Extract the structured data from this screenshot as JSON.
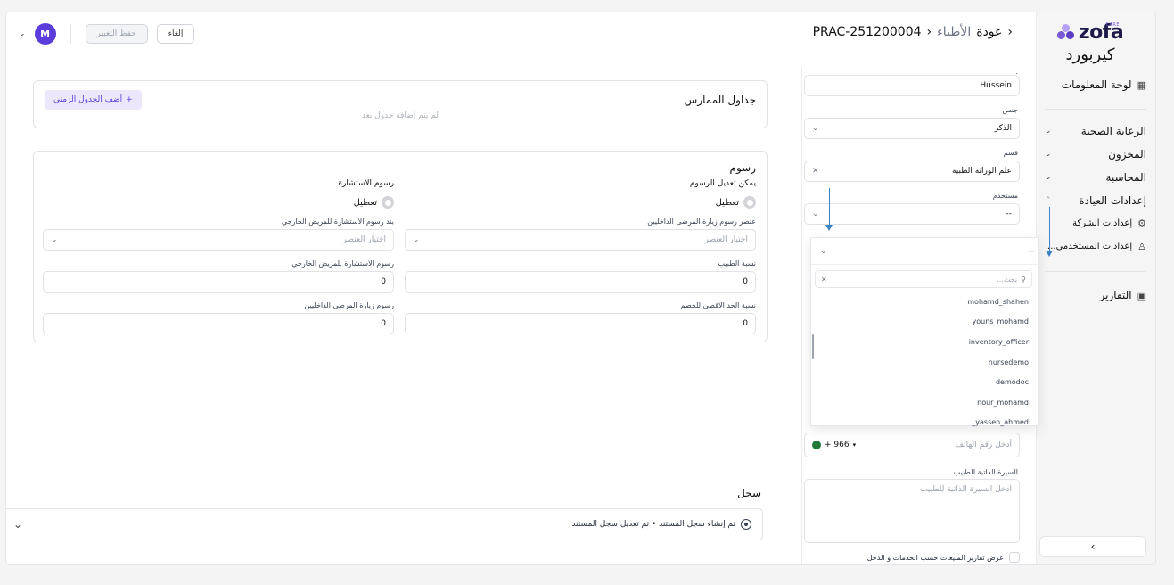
{
  "sidebar": {
    "logo_text": "zofa",
    "logo_badge": "CARE",
    "logo_subtitle": "كيربورد",
    "dashboard": "لوحة المعلومات",
    "healthcare": "الرعاية الصحية",
    "inventory": "المخزون",
    "accounting": "المحاسبة",
    "clinic_settings": "إعدادات العيادة",
    "company_settings": "إعدادات الشركة",
    "user_settings": "إعدادات المستخدمي...",
    "reports": "التقارير",
    "collapse": "›"
  },
  "header": {
    "back": "عودة",
    "section": "الأطباء",
    "record_id": "PRAC-251200004",
    "cancel": "إلغاء",
    "save": "حفظ التغيير",
    "avatar_initial": "M"
  },
  "form": {
    "top_label": ".",
    "name_value": "Hussein",
    "gender_label": "جنس",
    "gender_value": "الذكر",
    "department_label": "قسم",
    "department_value": "علم الوراثة الطبية",
    "user_label": "مستخدم",
    "user_value": "--",
    "phone_placeholder": "أدخل رقم الهاتف",
    "phone_code": "+ 966",
    "bio_label": "السيرة الذاتية للطبيب",
    "bio_placeholder": "ادخل السيرة الذاتية للطبيب",
    "sales_report_label": "عرض تقارير المبيعات حسب الخدمات و الدخل"
  },
  "dropdown": {
    "selected": "--",
    "search_placeholder": "بحث...",
    "options": [
      "mohamd_shahen",
      "youns_mohamd",
      "inventory_officer",
      "nursedemo",
      "demodoc",
      "nour_mohamd",
      "yassen_ahmed_"
    ]
  },
  "schedules": {
    "title": "جداول الممارس",
    "empty": "لم يتم إضافة جدول بعد",
    "add_button": "أضف الجدول الزمني"
  },
  "fees": {
    "title": "رسوم",
    "editable_label": "يمكن تعديل الرسوم",
    "editable_toggle": "تعطيل",
    "consult_label": "رسوم الاستشارة",
    "consult_toggle": "تعطيل",
    "inpatient_item_label": "عنصر رسوم زيارة المرضى الداخليين",
    "inpatient_item_placeholder": "اختيار العنصر",
    "outpatient_item_label": "بند رسوم الاستشارة للمريض الخارجي",
    "outpatient_item_placeholder": "اختيار العنصر",
    "doctor_pct_label": "نسبة الطبيب",
    "doctor_pct_value": "0",
    "outpatient_fee_label": "رسوم الاستشارة للمريض الخارجي",
    "outpatient_fee_value": "0",
    "max_discount_label": "نسبة الحد الاقصى للخصم",
    "max_discount_value": "0",
    "inpatient_fee_label": "رسوم زيارة المرضى الداخليين",
    "inpatient_fee_value": "0"
  },
  "log": {
    "title": "سجل",
    "entry": "تم إنشاء سجل المستند • تم تعديل سجل المستند"
  },
  "colors": {
    "accent": "#5b3ddb",
    "arrow": "#3b82c4"
  }
}
